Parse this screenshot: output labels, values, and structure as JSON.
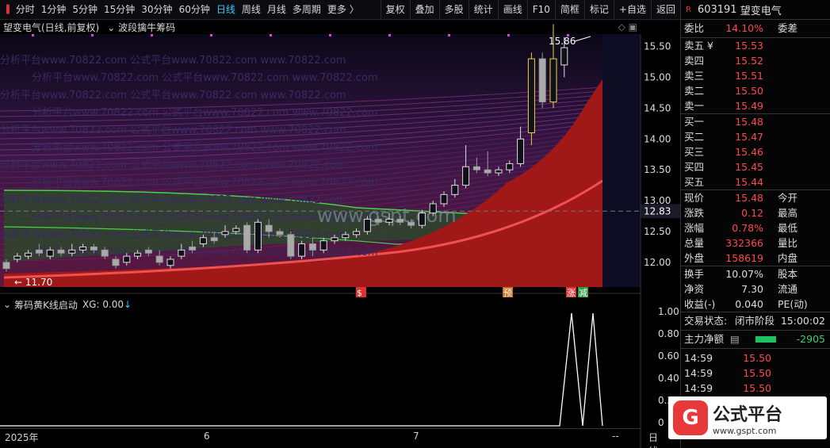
{
  "toolbar": {
    "left": [
      "分时",
      "1分钟",
      "5分钟",
      "15分钟",
      "30分钟",
      "60分钟",
      "日线",
      "周线",
      "月线",
      "多周期",
      "更多 〉"
    ],
    "active": "日线",
    "right": [
      "复权",
      "叠加",
      "多股",
      "统计",
      "画线",
      "F10",
      "简框",
      "标记",
      "+自选",
      "返回"
    ]
  },
  "chart": {
    "title": "望变电气(日线,前复权)",
    "indicator": "波段擒牛筹码",
    "price_labels": [
      "15.50",
      "15.00",
      "14.50",
      "14.00",
      "13.50",
      "13.00",
      "12.50",
      "12.00"
    ],
    "current_label": "12.83",
    "high_label": "15.86",
    "low_label": "11.70",
    "watermark": "www.gspt.com",
    "markers": [
      "$",
      "预",
      "涨",
      "减"
    ]
  },
  "sub": {
    "title": "筹码黄K线启动",
    "xg_label": "XG: 0.00",
    "axis": [
      "1.00",
      "0.80",
      "0.60",
      "0.40",
      "0.20",
      "0"
    ]
  },
  "date_axis": {
    "year": "2025年",
    "m6": "6",
    "m7": "7",
    "period": "日线",
    "dash": "--"
  },
  "quote": {
    "code": "603191",
    "name": "望变电气",
    "wb_label": "委比",
    "wb": "14.10%",
    "wc_label": "委差",
    "sell": [
      {
        "l": "卖五 ¥",
        "p": "15.53"
      },
      {
        "l": "卖四",
        "p": "15.52"
      },
      {
        "l": "卖三",
        "p": "15.51"
      },
      {
        "l": "卖二",
        "p": "15.50"
      },
      {
        "l": "卖一",
        "p": "15.49"
      }
    ],
    "buy": [
      {
        "l": "买一",
        "p": "15.48"
      },
      {
        "l": "买二",
        "p": "15.47"
      },
      {
        "l": "买三",
        "p": "15.46"
      },
      {
        "l": "买四",
        "p": "15.45"
      },
      {
        "l": "买五",
        "p": "15.44"
      }
    ],
    "stats": [
      {
        "l": "现价",
        "v": "15.48",
        "l2": "今开"
      },
      {
        "l": "涨跌",
        "v": "0.12",
        "l2": "最高"
      },
      {
        "l": "涨幅",
        "v": "0.78%",
        "l2": "最低"
      },
      {
        "l": "总量",
        "v": "332366",
        "l2": "量比"
      },
      {
        "l": "外盘",
        "v": "158619",
        "l2": "内盘"
      }
    ],
    "stats2": [
      {
        "l": "换手",
        "v": "10.07%",
        "l2": "股本"
      },
      {
        "l": "净资",
        "v": "7.30",
        "l2": "流通"
      },
      {
        "l": "收益(-)",
        "v": "0.040",
        "l2": "PE(动)"
      }
    ],
    "status_label": "交易状态:",
    "status": "闭市阶段",
    "status_time": "15:00:02",
    "main_label": "主力净额",
    "main_value": "-2905",
    "ticks": [
      {
        "t": "14:59",
        "p": "15.50"
      },
      {
        "t": "14:59",
        "p": "15.50"
      },
      {
        "t": "14:59",
        "p": "15.50"
      }
    ]
  },
  "brand": {
    "name": "公式平台",
    "url": "www.gspt.com",
    "logo_char": "G"
  }
}
